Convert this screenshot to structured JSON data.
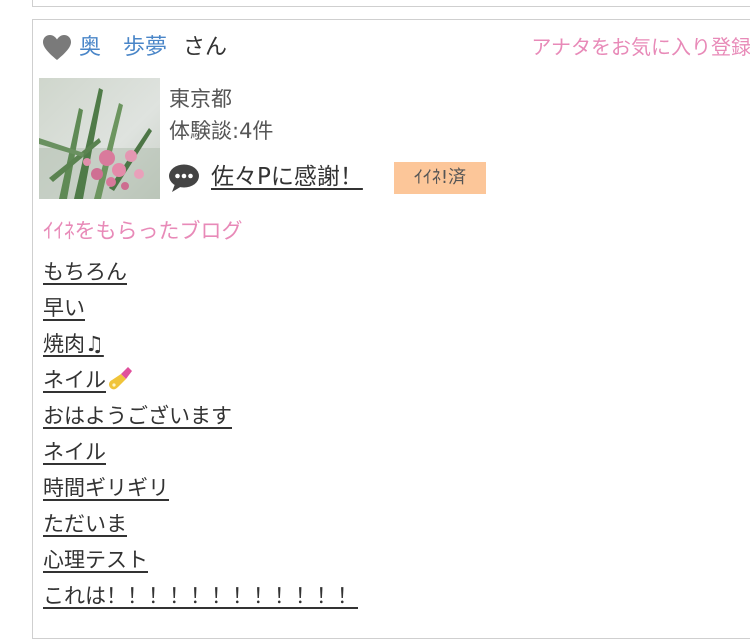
{
  "user": {
    "name": "奥　歩夢",
    "suffix": "さん",
    "favorite_status": "アナタをお気に入り登録済",
    "location": "東京都",
    "review_count": "体験談:4件",
    "comment": "佐々Pに感謝！",
    "like_badge": "ｲｲﾈ!済"
  },
  "blogs": {
    "title": "ｲｲﾈをもらったブログ",
    "items": [
      "もちろん",
      "早い",
      "焼肉♫",
      "ネイル",
      "おはようございます",
      "ネイル",
      "時間ギリギリ",
      "ただいま",
      "心理テスト",
      "これは！！！！！！！！！！！！"
    ]
  },
  "colors": {
    "accent_pink": "#e88ab8",
    "link_blue": "#4a86c8",
    "badge_bg": "#fcc699",
    "border": "#cfcfcf"
  },
  "icons": [
    "heart-icon",
    "chat-bubble-icon",
    "nail-polish-icon"
  ]
}
